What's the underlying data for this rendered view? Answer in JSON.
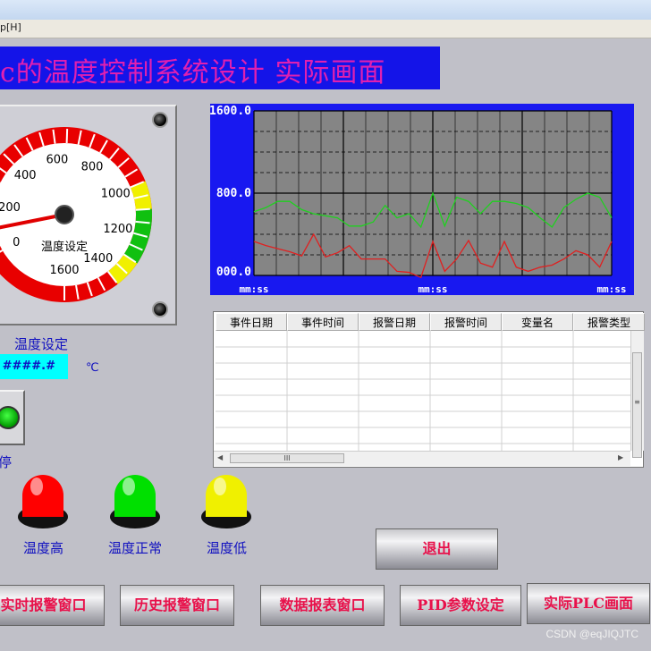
{
  "window": {
    "menu_fragment": "p[H]"
  },
  "header": {
    "title": "c的温度控制系统设计 实际画面"
  },
  "gauge": {
    "ticks": [
      "0",
      "200",
      "400",
      "600",
      "800",
      "1000",
      "1200",
      "1400",
      "1600"
    ],
    "caption": "温度设定",
    "max": 1600,
    "value": 100,
    "colors": {
      "red": "#e80000",
      "yellow": "#f0f000",
      "green": "#10c010"
    }
  },
  "setpoint": {
    "label": "温度设定",
    "value": "####.#",
    "unit": "℃"
  },
  "run_stop": {
    "label": "停"
  },
  "trend": {
    "y_ticks": [
      "1600.0",
      "800.0",
      "000.0"
    ],
    "x_ticks": [
      "mm:ss",
      "mm:ss",
      "mm:ss"
    ],
    "chart_data": {
      "type": "line",
      "ylim": [
        0,
        1600
      ],
      "x": [
        0,
        1,
        2,
        3,
        4,
        5,
        6,
        7,
        8,
        9,
        10,
        11,
        12,
        13,
        14,
        15,
        16,
        17,
        18,
        19,
        20,
        21,
        22,
        23,
        24,
        25,
        26,
        27,
        28,
        29,
        30
      ],
      "series": [
        {
          "color": "#20d020",
          "values": [
            620,
            660,
            720,
            720,
            640,
            600,
            580,
            560,
            480,
            480,
            520,
            680,
            560,
            600,
            470,
            800,
            480,
            760,
            720,
            600,
            720,
            720,
            700,
            660,
            560,
            470,
            660,
            740,
            800,
            760,
            560
          ]
        },
        {
          "color": "#e02020",
          "values": [
            330,
            290,
            260,
            230,
            190,
            400,
            180,
            220,
            290,
            160,
            160,
            160,
            40,
            30,
            -20,
            330,
            40,
            160,
            340,
            120,
            80,
            330,
            80,
            40,
            80,
            100,
            160,
            240,
            200,
            80,
            330
          ]
        }
      ]
    }
  },
  "alarm_table": {
    "columns": [
      "事件日期",
      "事件时间",
      "报警日期",
      "报警时间",
      "变量名",
      "报警类型"
    ],
    "scroll_thumb": "III"
  },
  "lamps": [
    {
      "label": "温度高",
      "color": "#ff0000"
    },
    {
      "label": "温度正常",
      "color": "#00e000"
    },
    {
      "label": "温度低",
      "color": "#f0f000"
    }
  ],
  "buttons": {
    "exit": "退出",
    "realtime_alarm": "实时报警窗口",
    "history_alarm": "历史报警窗口",
    "data_report": "数据报表窗口",
    "pid_settings": "PID参数设定",
    "actual_plc": "实际PLC画面"
  },
  "watermark": "CSDN @eqJIQJTC"
}
